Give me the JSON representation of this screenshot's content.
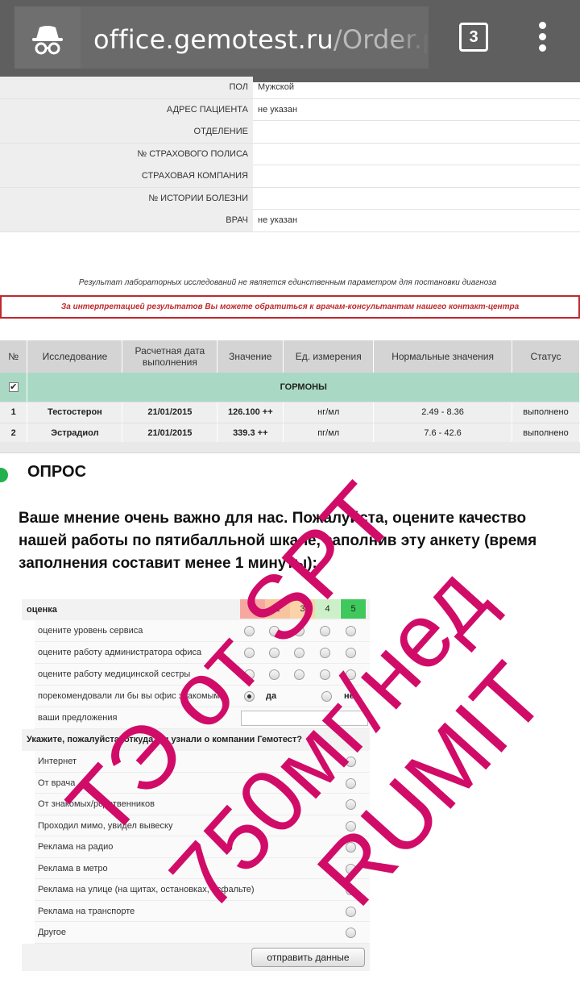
{
  "browser": {
    "url_host": "office.gemotest.ru",
    "url_path": "/Order.p",
    "tab_count": "3"
  },
  "patient_info": [
    {
      "label": "ПОЛ",
      "value": "Мужской"
    },
    {
      "label": "АДРЕС ПАЦИЕНТА",
      "value": "не указан"
    },
    {
      "label": "ОТДЕЛЕНИЕ",
      "value": ""
    },
    {
      "label": "№ СТРАХОВОГО ПОЛИСА",
      "value": ""
    },
    {
      "label": "СТРАХОВАЯ КОМПАНИЯ",
      "value": ""
    },
    {
      "label": "№ ИСТОРИИ БОЛЕЗНИ",
      "value": ""
    },
    {
      "label": "ВРАЧ",
      "value": "не указан"
    }
  ],
  "notes": {
    "disclaimer": "Результат лабораторных исследований не является единственным параметром для постановки диагноза",
    "contact": "За интерпретацией результатов Вы можете обратиться к врачам-консультантам нашего контакт-центра"
  },
  "results": {
    "headers": [
      "№",
      "Исследование",
      "Расчетная дата выполнения",
      "Значение",
      "Ед. измерения",
      "Нормальные значения",
      "Статус"
    ],
    "group_name": "ГОРМОНЫ",
    "rows": [
      {
        "num": "1",
        "test": "Тестостерон",
        "date": "21/01/2015",
        "value": "126.100 ++",
        "unit": "нг/мл",
        "norm": "2.49 - 8.36",
        "status": "выполнено"
      },
      {
        "num": "2",
        "test": "Эстрадиол",
        "date": "21/01/2015",
        "value": "339.3 ++",
        "unit": "пг/мл",
        "norm": "7.6 - 42.6",
        "status": "выполнено"
      }
    ]
  },
  "survey": {
    "title": "ОПРОС",
    "intro": "Ваше мнение очень важно для нас. Пожалуйста, оцените качество нашей работы по пятибалльной шкале, заполнив эту анкету (время заполнения составит менее 1 минуты):",
    "rating_label": "оценка",
    "scores": [
      {
        "label": "1",
        "color": "#f6a8a0"
      },
      {
        "label": "2",
        "color": "#f8c4a0"
      },
      {
        "label": "3",
        "color": "#fbd3a8"
      },
      {
        "label": "4",
        "color": "#cdf0c8"
      },
      {
        "label": "5",
        "color": "#3fc85c"
      }
    ],
    "questions": [
      "оцените уровень сервиса",
      "оцените работу администратора офиса",
      "оцените работу медицинской сестры"
    ],
    "recommend_question": "порекомендовали ли бы вы офис знакомым?",
    "recommend_yes": "да",
    "recommend_no": "нет",
    "suggestions_label": "ваши предложения",
    "source_question": "Укажите, пожалуйста, откуда вы узнали о компании Гемотест?",
    "sources": [
      "Интернет",
      "От врача",
      "От знакомых/родственников",
      "Проходил мимо, увидел вывеску",
      "Реклама на радио",
      "Реклама в метро",
      "Реклама на улице (на щитах, остановках, асфальте)",
      "Реклама на транспорте",
      "Другое"
    ],
    "submit_label": "отправить данные"
  },
  "watermark": {
    "line1": "ТЭ от SPT",
    "line2": "750мг/нед",
    "line3": "RUMIT",
    "color": "#d10c68"
  }
}
